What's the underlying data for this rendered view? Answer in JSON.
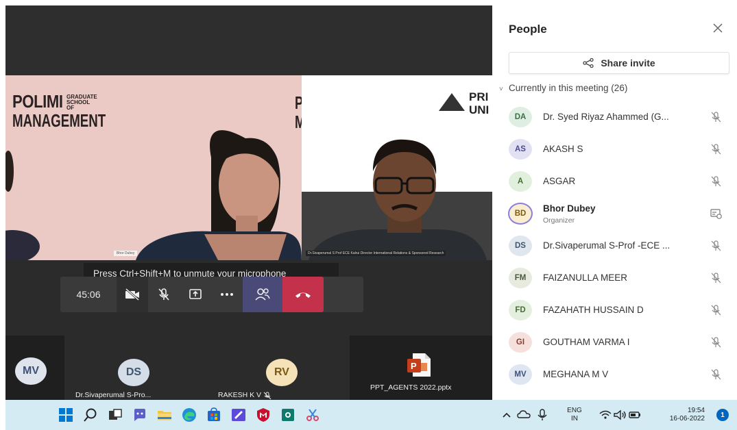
{
  "meeting": {
    "left_tile": {
      "brand_line1": "POLIMI",
      "brand_small": "GRADUATE SCHOOL OF",
      "brand_line2": "MANAGEMENT",
      "brand_cut": "P M",
      "name_tag": "Bhor Dubey"
    },
    "right_tile": {
      "logo_text_1": "PRI",
      "logo_text_2": "UNI",
      "caption": "Dr.Sivaperumal S Prof ECE Kalrui Director International Relations & Sponsored Research"
    },
    "toast_text": "Press Ctrl+Shift+M to unmute your microphone",
    "control_bar": {
      "timer": "45:06"
    },
    "bottom_tiles": [
      {
        "initials": "MV",
        "name": ""
      },
      {
        "initials": "DS",
        "name": "Dr.Sivaperumal S-Pro..."
      },
      {
        "initials": "RV",
        "name": "RAKESH K V"
      },
      {
        "initials": "",
        "name": "PPT_AGENTS 2022.pptx"
      }
    ]
  },
  "people_panel": {
    "title": "People",
    "share_invite_label": "Share invite",
    "meeting_header": "Currently in this meeting (26)",
    "participants": [
      {
        "initials": "DA",
        "name": "Dr. Syed Riyaz Ahammed (G...",
        "role": "",
        "avatar_bg": "#dfeee3",
        "avatar_fg": "#3b6e45"
      },
      {
        "initials": "AS",
        "name": "AKASH S",
        "role": "",
        "avatar_bg": "#e2e0f3",
        "avatar_fg": "#4f4a8c"
      },
      {
        "initials": "A",
        "name": "ASGAR",
        "role": "",
        "avatar_bg": "#e1f0dd",
        "avatar_fg": "#3f6f35"
      },
      {
        "initials": "BD",
        "name": "Bhor Dubey",
        "role": "Organizer",
        "avatar_bg": "#fbeed0",
        "avatar_fg": "#7a5a10"
      },
      {
        "initials": "DS",
        "name": "Dr.Sivaperumal S-Prof -ECE ...",
        "role": "",
        "avatar_bg": "#dfe6ee",
        "avatar_fg": "#3e556e"
      },
      {
        "initials": "FM",
        "name": "FAIZANULLA MEER",
        "role": "",
        "avatar_bg": "#e6eadf",
        "avatar_fg": "#4a5a3c"
      },
      {
        "initials": "FD",
        "name": "FAZAHATH HUSSAIN D",
        "role": "",
        "avatar_bg": "#e4efdd",
        "avatar_fg": "#4a6b3a"
      },
      {
        "initials": "GI",
        "name": "GOUTHAM VARMA I",
        "role": "",
        "avatar_bg": "#f6e0dc",
        "avatar_fg": "#8a3b30"
      },
      {
        "initials": "MV",
        "name": "MEGHANA M V",
        "role": "",
        "avatar_bg": "#e0e6f1",
        "avatar_fg": "#3c5078"
      }
    ]
  },
  "taskbar": {
    "lang_line1": "ENG",
    "lang_line2": "IN",
    "time": "19:54",
    "date": "16-06-2022",
    "notification_count": "1"
  },
  "colors": {
    "hangup": "#c4314b",
    "people_button_active": "#4a4a78",
    "taskbar_bg": "#d4ebf4",
    "accent": "#0067c0"
  }
}
